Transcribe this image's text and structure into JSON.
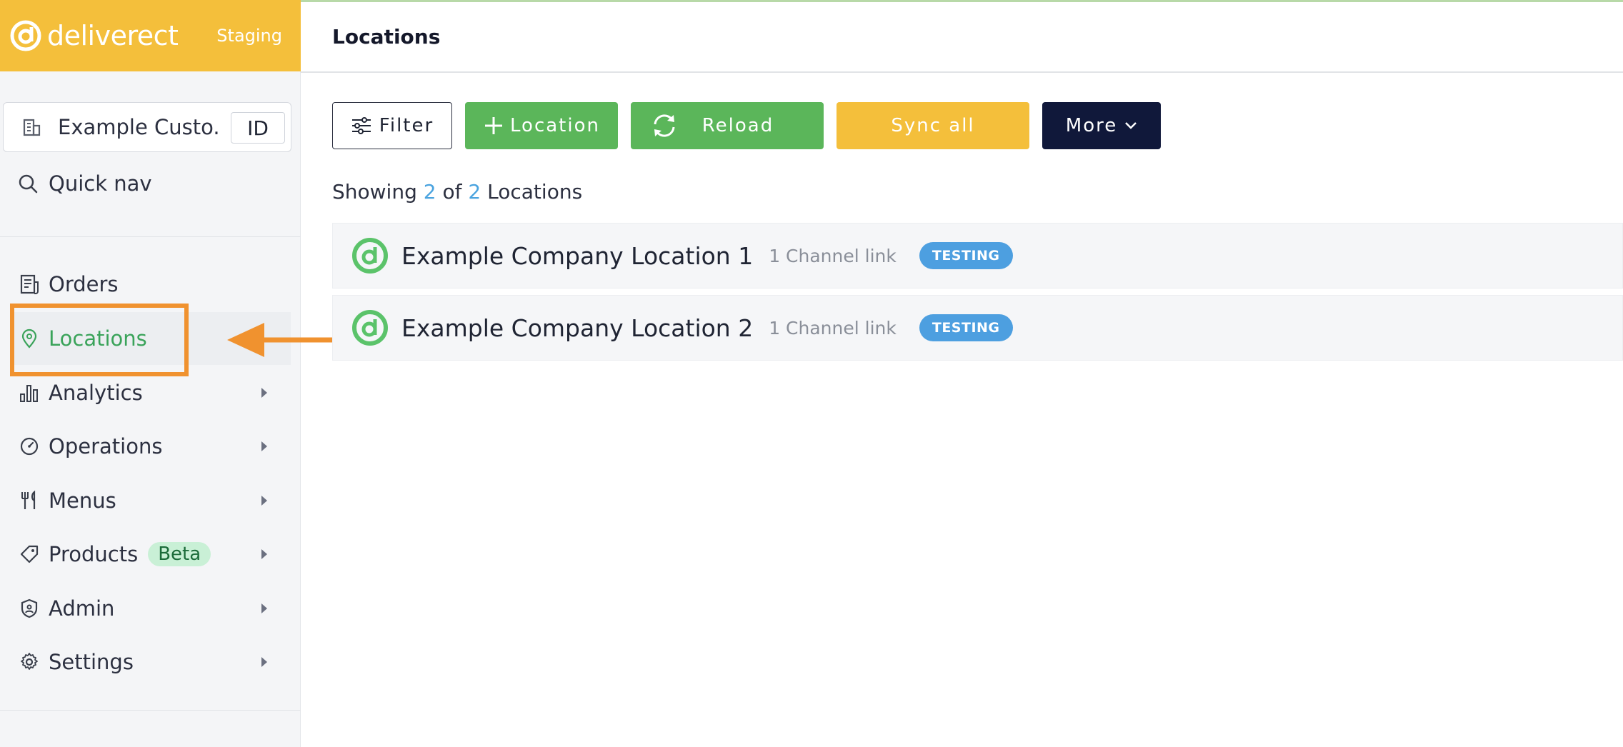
{
  "brand": {
    "name": "deliverect",
    "environment": "Staging",
    "color": "#f4bf3b"
  },
  "account": {
    "name": "Example Custo...",
    "id_label": "ID"
  },
  "quicknav": {
    "label": "Quick nav"
  },
  "nav": {
    "items": [
      {
        "label": "Orders",
        "icon": "receipt-icon"
      },
      {
        "label": "Locations",
        "icon": "map-pin-icon",
        "active": true
      },
      {
        "label": "Analytics",
        "icon": "bar-chart-icon"
      },
      {
        "label": "Operations",
        "icon": "gauge-icon"
      },
      {
        "label": "Menus",
        "icon": "utensils-icon"
      },
      {
        "label": "Products",
        "icon": "tag-icon",
        "badge": "Beta"
      },
      {
        "label": "Admin",
        "icon": "shield-icon"
      },
      {
        "label": "Settings",
        "icon": "gear-icon"
      }
    ]
  },
  "header": {
    "title": "Locations"
  },
  "toolbar": {
    "filter": "Filter",
    "add_location": "Location",
    "reload": "Reload",
    "sync_all": "Sync all",
    "more": "More"
  },
  "summary": {
    "prefix": "Showing",
    "shown": "2",
    "of": "of",
    "total": "2",
    "suffix": "Locations"
  },
  "locations": [
    {
      "name": "Example Company Location 1",
      "channels": "1 Channel link",
      "tag": "TESTING"
    },
    {
      "name": "Example Company Location 2",
      "channels": "1 Channel link",
      "tag": "TESTING"
    }
  ],
  "colors": {
    "accent_green": "#5bb65a",
    "accent_yellow": "#f4bf3b",
    "dark_navy": "#10183a",
    "tag_blue": "#4d9fe0",
    "annotation_orange": "#f0922f"
  }
}
